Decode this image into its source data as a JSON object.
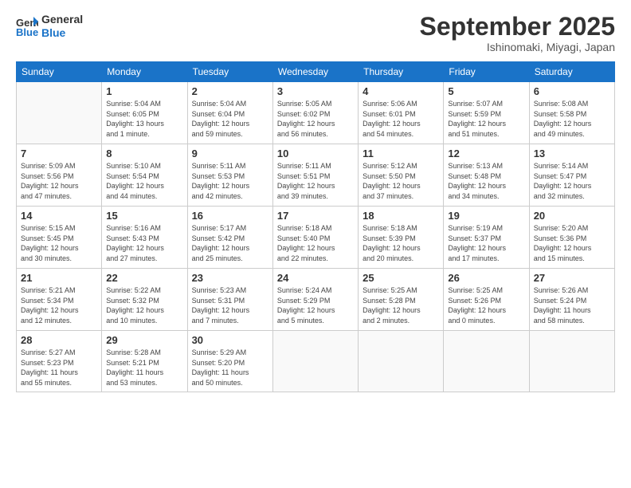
{
  "logo": {
    "line1": "General",
    "line2": "Blue"
  },
  "title": "September 2025",
  "location": "Ishinomaki, Miyagi, Japan",
  "days_of_week": [
    "Sunday",
    "Monday",
    "Tuesday",
    "Wednesday",
    "Thursday",
    "Friday",
    "Saturday"
  ],
  "weeks": [
    [
      {
        "day": "",
        "info": ""
      },
      {
        "day": "1",
        "info": "Sunrise: 5:04 AM\nSunset: 6:05 PM\nDaylight: 13 hours\nand 1 minute."
      },
      {
        "day": "2",
        "info": "Sunrise: 5:04 AM\nSunset: 6:04 PM\nDaylight: 12 hours\nand 59 minutes."
      },
      {
        "day": "3",
        "info": "Sunrise: 5:05 AM\nSunset: 6:02 PM\nDaylight: 12 hours\nand 56 minutes."
      },
      {
        "day": "4",
        "info": "Sunrise: 5:06 AM\nSunset: 6:01 PM\nDaylight: 12 hours\nand 54 minutes."
      },
      {
        "day": "5",
        "info": "Sunrise: 5:07 AM\nSunset: 5:59 PM\nDaylight: 12 hours\nand 51 minutes."
      },
      {
        "day": "6",
        "info": "Sunrise: 5:08 AM\nSunset: 5:58 PM\nDaylight: 12 hours\nand 49 minutes."
      }
    ],
    [
      {
        "day": "7",
        "info": "Sunrise: 5:09 AM\nSunset: 5:56 PM\nDaylight: 12 hours\nand 47 minutes."
      },
      {
        "day": "8",
        "info": "Sunrise: 5:10 AM\nSunset: 5:54 PM\nDaylight: 12 hours\nand 44 minutes."
      },
      {
        "day": "9",
        "info": "Sunrise: 5:11 AM\nSunset: 5:53 PM\nDaylight: 12 hours\nand 42 minutes."
      },
      {
        "day": "10",
        "info": "Sunrise: 5:11 AM\nSunset: 5:51 PM\nDaylight: 12 hours\nand 39 minutes."
      },
      {
        "day": "11",
        "info": "Sunrise: 5:12 AM\nSunset: 5:50 PM\nDaylight: 12 hours\nand 37 minutes."
      },
      {
        "day": "12",
        "info": "Sunrise: 5:13 AM\nSunset: 5:48 PM\nDaylight: 12 hours\nand 34 minutes."
      },
      {
        "day": "13",
        "info": "Sunrise: 5:14 AM\nSunset: 5:47 PM\nDaylight: 12 hours\nand 32 minutes."
      }
    ],
    [
      {
        "day": "14",
        "info": "Sunrise: 5:15 AM\nSunset: 5:45 PM\nDaylight: 12 hours\nand 30 minutes."
      },
      {
        "day": "15",
        "info": "Sunrise: 5:16 AM\nSunset: 5:43 PM\nDaylight: 12 hours\nand 27 minutes."
      },
      {
        "day": "16",
        "info": "Sunrise: 5:17 AM\nSunset: 5:42 PM\nDaylight: 12 hours\nand 25 minutes."
      },
      {
        "day": "17",
        "info": "Sunrise: 5:18 AM\nSunset: 5:40 PM\nDaylight: 12 hours\nand 22 minutes."
      },
      {
        "day": "18",
        "info": "Sunrise: 5:18 AM\nSunset: 5:39 PM\nDaylight: 12 hours\nand 20 minutes."
      },
      {
        "day": "19",
        "info": "Sunrise: 5:19 AM\nSunset: 5:37 PM\nDaylight: 12 hours\nand 17 minutes."
      },
      {
        "day": "20",
        "info": "Sunrise: 5:20 AM\nSunset: 5:36 PM\nDaylight: 12 hours\nand 15 minutes."
      }
    ],
    [
      {
        "day": "21",
        "info": "Sunrise: 5:21 AM\nSunset: 5:34 PM\nDaylight: 12 hours\nand 12 minutes."
      },
      {
        "day": "22",
        "info": "Sunrise: 5:22 AM\nSunset: 5:32 PM\nDaylight: 12 hours\nand 10 minutes."
      },
      {
        "day": "23",
        "info": "Sunrise: 5:23 AM\nSunset: 5:31 PM\nDaylight: 12 hours\nand 7 minutes."
      },
      {
        "day": "24",
        "info": "Sunrise: 5:24 AM\nSunset: 5:29 PM\nDaylight: 12 hours\nand 5 minutes."
      },
      {
        "day": "25",
        "info": "Sunrise: 5:25 AM\nSunset: 5:28 PM\nDaylight: 12 hours\nand 2 minutes."
      },
      {
        "day": "26",
        "info": "Sunrise: 5:25 AM\nSunset: 5:26 PM\nDaylight: 12 hours\nand 0 minutes."
      },
      {
        "day": "27",
        "info": "Sunrise: 5:26 AM\nSunset: 5:24 PM\nDaylight: 11 hours\nand 58 minutes."
      }
    ],
    [
      {
        "day": "28",
        "info": "Sunrise: 5:27 AM\nSunset: 5:23 PM\nDaylight: 11 hours\nand 55 minutes."
      },
      {
        "day": "29",
        "info": "Sunrise: 5:28 AM\nSunset: 5:21 PM\nDaylight: 11 hours\nand 53 minutes."
      },
      {
        "day": "30",
        "info": "Sunrise: 5:29 AM\nSunset: 5:20 PM\nDaylight: 11 hours\nand 50 minutes."
      },
      {
        "day": "",
        "info": ""
      },
      {
        "day": "",
        "info": ""
      },
      {
        "day": "",
        "info": ""
      },
      {
        "day": "",
        "info": ""
      }
    ]
  ]
}
